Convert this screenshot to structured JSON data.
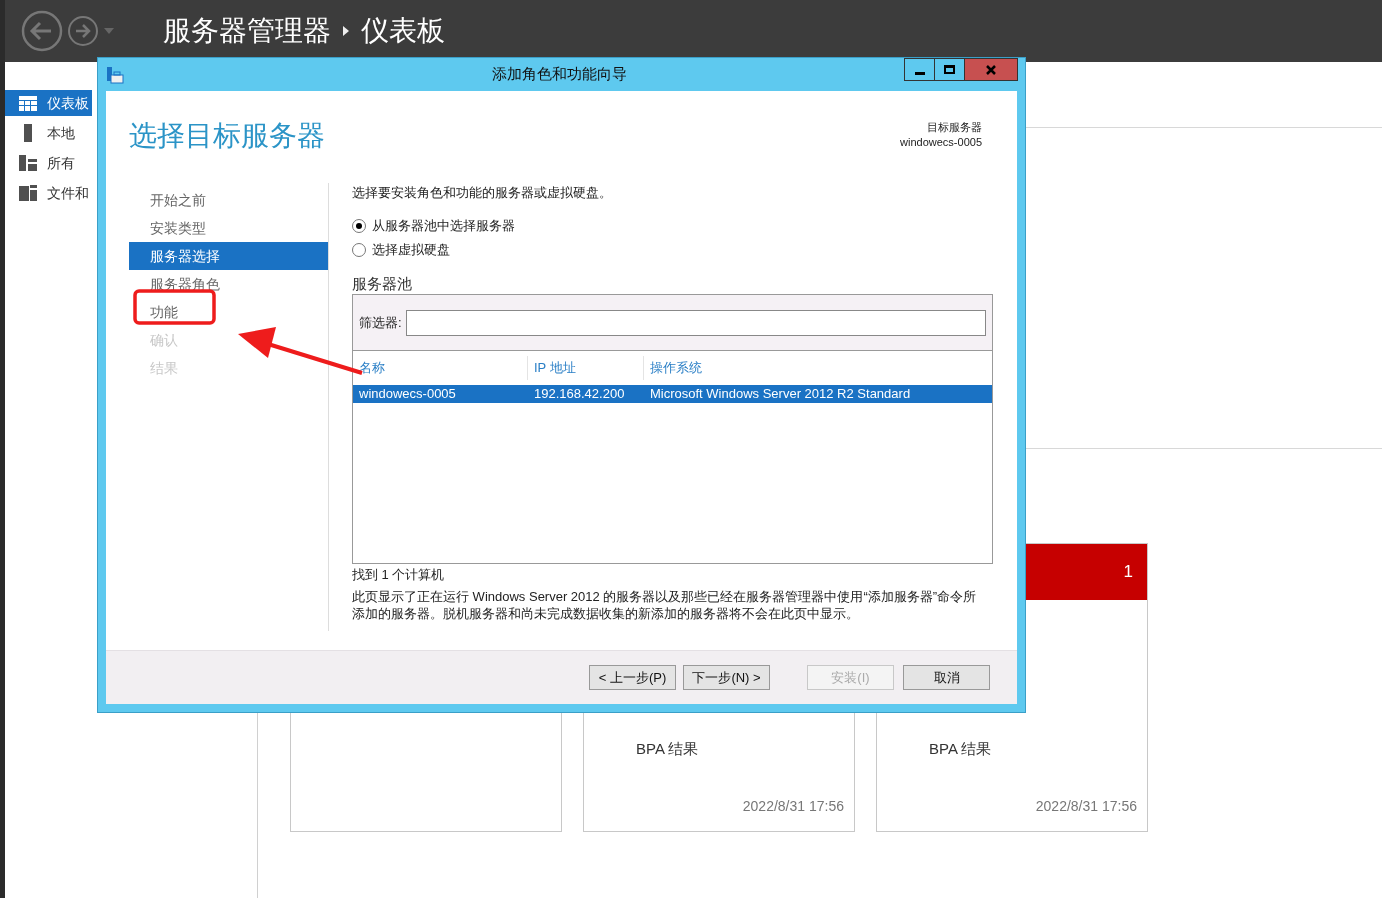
{
  "header": {
    "breadcrumb": [
      "服务器管理器",
      "仪表板"
    ]
  },
  "sidebar": {
    "items": [
      {
        "label": "仪表板",
        "selected": true
      },
      {
        "label": "本地",
        "selected": false
      },
      {
        "label": "所有",
        "selected": false
      },
      {
        "label": "文件和",
        "selected": false
      }
    ]
  },
  "tiles": [
    {
      "kind": "blank"
    },
    {
      "kind": "summary",
      "label": "BPA 结果",
      "time": "2022/8/31 17:56"
    },
    {
      "kind": "summary",
      "alert": true,
      "count": "1",
      "label": "BPA 结果",
      "time": "2022/8/31 17:56"
    }
  ],
  "dialog": {
    "title": "添加角色和功能向导",
    "heading": "选择目标服务器",
    "target_label": "目标服务器",
    "target_value": "windowecs-0005",
    "steps": [
      {
        "label": "开始之前",
        "selected": false,
        "disabled": false
      },
      {
        "label": "安装类型",
        "selected": false,
        "disabled": false
      },
      {
        "label": "服务器选择",
        "selected": true,
        "disabled": false
      },
      {
        "label": "服务器角色",
        "selected": false,
        "disabled": false
      },
      {
        "label": "功能",
        "selected": false,
        "disabled": false
      },
      {
        "label": "确认",
        "selected": false,
        "disabled": true
      },
      {
        "label": "结果",
        "selected": false,
        "disabled": true
      }
    ],
    "instruction": "选择要安装角色和功能的服务器或虚拟硬盘。",
    "options": [
      {
        "label": "从服务器池中选择服务器",
        "selected": true
      },
      {
        "label": "选择虚拟硬盘",
        "selected": false
      }
    ],
    "pool_label": "服务器池",
    "filter_label": "筛选器:",
    "columns": [
      "名称",
      "IP 地址",
      "操作系统"
    ],
    "rows": [
      {
        "cells": [
          "windowecs-0005",
          "192.168.42.200",
          "Microsoft Windows Server 2012 R2 Standard"
        ],
        "selected": true
      }
    ],
    "found": "找到 1 个计算机",
    "note": "此页显示了正在运行 Windows Server 2012 的服务器以及那些已经在服务器管理器中使用“添加服务器”命令所添加的服务器。脱机服务器和尚未完成数据收集的新添加的服务器将不会在此页中显示。",
    "buttons": [
      {
        "label": "< 上一步(P)",
        "disabled": false
      },
      {
        "label": "下一步(N) >",
        "disabled": false
      },
      {
        "label": "安装(I)",
        "disabled": true
      },
      {
        "label": "取消",
        "disabled": false
      }
    ]
  },
  "annotations": {
    "highlight_box": true,
    "arrow": true
  }
}
